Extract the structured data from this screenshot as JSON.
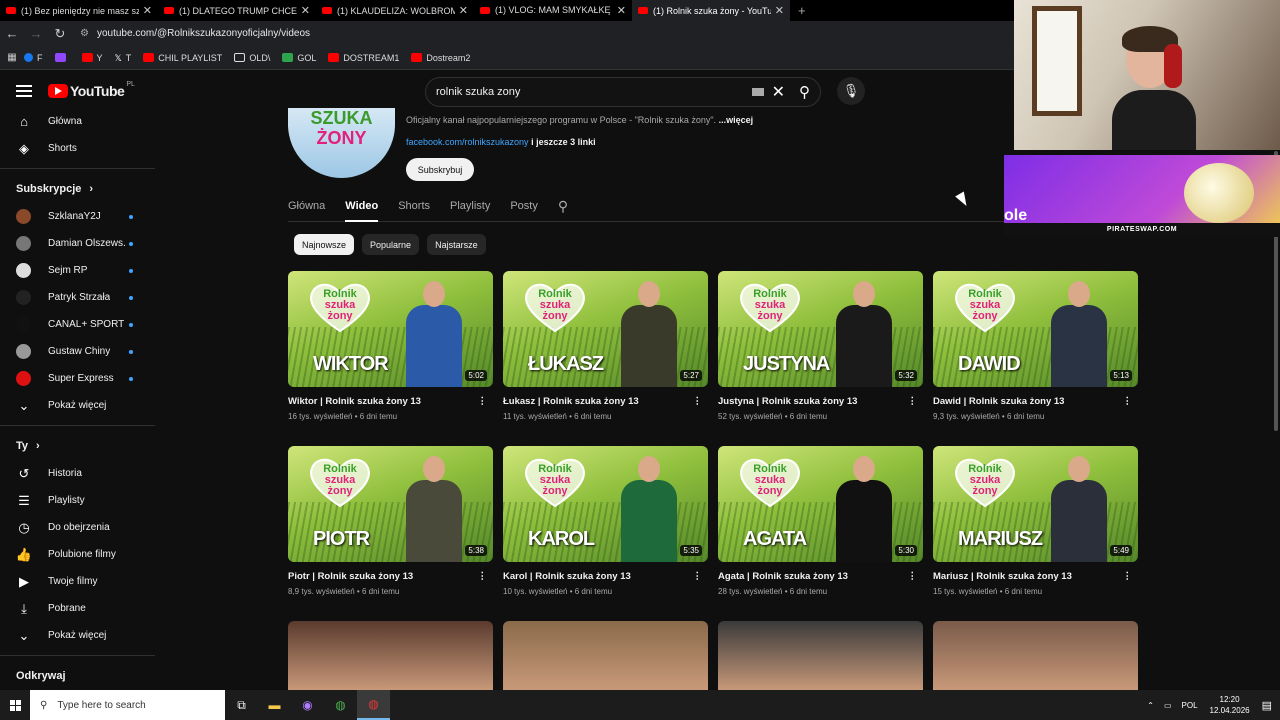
{
  "browser": {
    "tabs": [
      {
        "title": "(1) Bez pieniędzy nie masz szans",
        "active": false
      },
      {
        "title": "(1) DLATEGO TRUMP CHCE WYWOŁAĆ",
        "active": false
      },
      {
        "title": "(1) KLAUDELIZA: WOLBROMSKA",
        "active": false
      },
      {
        "title": "(1) VLOG: MAM SMYKAŁKĘ 🤑",
        "active": false
      },
      {
        "title": "(1) Rolnik szuka żony - YouTube",
        "active": true
      }
    ],
    "new_tab": "+",
    "url": "youtube.com/@Rolnikszukazonyoficjalny/videos",
    "bookmarks": [
      "F",
      "Y",
      "T",
      "CHIL PLAYLIST",
      "OLD\\",
      "GOL",
      "DOSTREAM1",
      "Dostream2"
    ]
  },
  "youtube": {
    "logo": "YouTube",
    "country": "PL",
    "search_value": "rolnik szuka zony",
    "sidebar": {
      "main": [
        {
          "label": "Główna",
          "icon": "home-icon"
        },
        {
          "label": "Shorts",
          "icon": "shorts-icon"
        }
      ],
      "subs_title": "Subskrypcje",
      "subs": [
        {
          "label": "SzklanaY2J",
          "color": "#8a4a2a"
        },
        {
          "label": "Damian Olszews...",
          "color": "#777"
        },
        {
          "label": "Sejm RP",
          "color": "#ddd"
        },
        {
          "label": "Patryk Strzała",
          "color": "#222"
        },
        {
          "label": "CANAL+ SPORT",
          "color": "#111"
        },
        {
          "label": "Gustaw Chiny",
          "color": "#999"
        },
        {
          "label": "Super Express",
          "color": "#d11"
        }
      ],
      "show_more": "Pokaż więcej",
      "you_title": "Ty",
      "you": [
        {
          "label": "Historia",
          "icon": "history-icon"
        },
        {
          "label": "Playlisty",
          "icon": "playlist-icon"
        },
        {
          "label": "Do obejrzenia",
          "icon": "watch-later-icon"
        },
        {
          "label": "Polubione filmy",
          "icon": "like-icon"
        },
        {
          "label": "Twoje filmy",
          "icon": "your-videos-icon"
        },
        {
          "label": "Pobrane",
          "icon": "download-icon"
        },
        {
          "label": "Pokaż więcej",
          "icon": "chevron-down-icon"
        }
      ],
      "explore_title": "Odkrywaj"
    },
    "channel": {
      "avatar_line1": "SZUKA",
      "avatar_line2": "ŻONY",
      "description": "Oficjalny kanał najpopularniejszego programu w Polsce - \"Rolnik szuka żony\".",
      "more": "...więcej",
      "link": "facebook.com/rolnikszukazony",
      "link_more": "i jeszcze 3 linki",
      "subscribe": "Subskrybuj",
      "tabs": [
        "Główna",
        "Wideo",
        "Shorts",
        "Playlisty",
        "Posty"
      ],
      "active_tab": "Wideo"
    },
    "chips": [
      "Najnowsze",
      "Popularne",
      "Najstarsze"
    ],
    "videos": [
      {
        "name": "WIKTOR",
        "title": "Wiktor | Rolnik szuka żony 13",
        "views": "16 tys. wyświetleń",
        "age": "6 dni temu",
        "duration": "5:02",
        "shirt": "#2a5aa8"
      },
      {
        "name": "ŁUKASZ",
        "title": "Łukasz | Rolnik szuka żony 13",
        "views": "11 tys. wyświetleń",
        "age": "6 dni temu",
        "duration": "5:27",
        "shirt": "#3a3a2a"
      },
      {
        "name": "JUSTYNA",
        "title": "Justyna | Rolnik szuka żony 13",
        "views": "52 tys. wyświetleń",
        "age": "6 dni temu",
        "duration": "5:32",
        "shirt": "#1a1a1a"
      },
      {
        "name": "DAWID",
        "title": "Dawid | Rolnik szuka żony 13",
        "views": "9,3 tys. wyświetleń",
        "age": "6 dni temu",
        "duration": "5:13",
        "shirt": "#2a3344"
      },
      {
        "name": "PIOTR",
        "title": "Piotr | Rolnik szuka żony 13",
        "views": "8,9 tys. wyświetleń",
        "age": "6 dni temu",
        "duration": "5:38",
        "shirt": "#4a4a3a"
      },
      {
        "name": "KAROL",
        "title": "Karol | Rolnik szuka żony 13",
        "views": "10 tys. wyświetleń",
        "age": "6 dni temu",
        "duration": "5:35",
        "shirt": "#1f6a3a"
      },
      {
        "name": "AGATA",
        "title": "Agata | Rolnik szuka żony 13",
        "views": "28 tys. wyświetleń",
        "age": "6 dni temu",
        "duration": "5:30",
        "shirt": "#111111"
      },
      {
        "name": "MARIUSZ",
        "title": "Mariusz | Rolnik szuka żony 13",
        "views": "15 tys. wyświetleń",
        "age": "6 dni temu",
        "duration": "5:49",
        "shirt": "#2a2f3a"
      }
    ],
    "thumb_heart_a": "Rolnik",
    "thumb_heart_b": "szuka",
    "thumb_heart_c": "żony"
  },
  "ad": {
    "text": "PIRATESWAP.COM",
    "left_text": "ole"
  },
  "taskbar": {
    "search_placeholder": "Type here to search",
    "lang": "POL",
    "time": "12:20",
    "date": "12.04.2026"
  }
}
